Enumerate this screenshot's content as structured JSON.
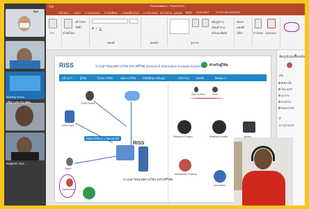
{
  "titlebar": {
    "title": "Presentation1 - PowerPoint",
    "left_text": "ไฟล์"
  },
  "tabs": [
    "หน้าแรก",
    "แทรก",
    "การออกแบบ",
    "การเปลี่ยน",
    "ภาพเคลื่อนไหว",
    "การนำเสนอ",
    "ตรวจทาน",
    "มุมมอง",
    "วิธีใช้",
    "ACROBAT",
    "STORYBOARDING"
  ],
  "participants": [
    {
      "name": "Ruf",
      "label": ""
    },
    {
      "name": "",
      "label": ""
    },
    {
      "name": "Meeting Room",
      "label": "Meeting Room"
    },
    {
      "name": "",
      "label": "ปรีดา ประวัน ยศสุ..."
    },
    {
      "name": "Support: Sur...",
      "label": "Support: Sur..."
    }
  ],
  "ribbon": {
    "paste": "วาง",
    "new_slide": "สไลด์ใหม่",
    "reuse": "ใช้ซ้ำ",
    "layout": "เค้าโครง",
    "font_group": "ฟอนต์",
    "paragraph_group": "ย่อหน้า",
    "drawing_group": "รูปวาด",
    "shape_fill": "เติมรูปร่าง",
    "shape_outline": "เส้นเค้าร่าง",
    "shape_effect": "ลักษณะพิเศษ",
    "find": "ค้นหา",
    "replace": "แทนที่",
    "select": "เลือก",
    "dictate": "การบอก",
    "designer": "ออกแบบ"
  },
  "slide": {
    "logo": "RISS",
    "subtitle": "ระบบสารสนเทศงานวิจัย มรภ.ศรีวิชัย (Research Information Srivijaya Systems)",
    "right_title": "สำหรับผู้วิจัย",
    "nav_items": [
      "หน้าแรก",
      "ผู้วิจัย",
      "โครงการวิจัย",
      "บทความวิจัย",
      "ทรัพย์สินทางปัญญา",
      "นวัตกรรม",
      "หนังสือ",
      "ติดต่อเรา"
    ],
    "url": "https://riss.rmutsv.ac.th/",
    "riss_label": "ระบบสารสนเทศงานวิจัย มทร.ศรีวิชัย",
    "left_nodes": [
      "RISS Staff",
      "Research Staff",
      "RISS Board",
      "Users",
      "Researcher"
    ],
    "right_nodes": [
      "Research Project",
      "Research Article",
      "Books",
      "Intellectual Property",
      "Innovation",
      "Add Co-Res",
      "Done"
    ]
  },
  "side_panel": {
    "title": "จัดรูปแบบพื้นหลัง",
    "fill_label": "เติม",
    "options": [
      "สีเดียวทึบ",
      "ไล่ระดับสี",
      "รูปภาพ",
      "ลวดลาย",
      "ซ่อนกราฟิก"
    ],
    "color_label": "สี",
    "transparency_label": "ความโปร่งใส"
  }
}
